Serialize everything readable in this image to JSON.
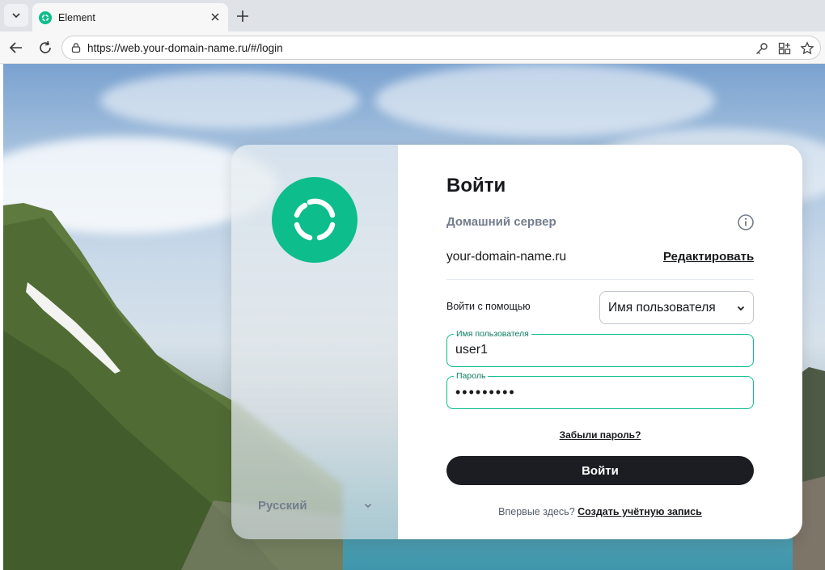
{
  "browser": {
    "tab_title": "Element",
    "url_prefix": "https://",
    "url_host": "web.your-domain-name.ru",
    "url_path": "/#/login"
  },
  "colors": {
    "brand": "#0dbd8b",
    "primary_button": "#1b1d22"
  },
  "icons": {
    "tab_list": "chevron-down-icon",
    "tab_favicon": "element-logo-icon",
    "tab_close": "close-icon",
    "new_tab": "plus-icon",
    "back": "arrow-left-icon",
    "reload": "reload-icon",
    "site_info": "lock-icon",
    "password_manager": "key-icon",
    "extensions": "apps-icon",
    "favorite": "star-icon",
    "info": "info-icon",
    "select_chevron": "chevron-down-icon",
    "language_chevron": "chevron-down-icon"
  },
  "left_panel": {
    "language": "Русский"
  },
  "login": {
    "title": "Войти",
    "homeserver_label": "Домашний сервер",
    "homeserver_value": "your-domain-name.ru",
    "edit_label": "Редактировать",
    "login_with_label": "Войти с помощью",
    "login_with_selected": "Имя пользователя",
    "username_label": "Имя пользователя",
    "username_value": "user1",
    "password_label": "Пароль",
    "password_value": "•••••••••",
    "forgot_label": "Забыли пароль?",
    "submit_label": "Войти",
    "new_here_text": "Впервые здесь?",
    "create_account_label": "Создать учётную запись"
  }
}
